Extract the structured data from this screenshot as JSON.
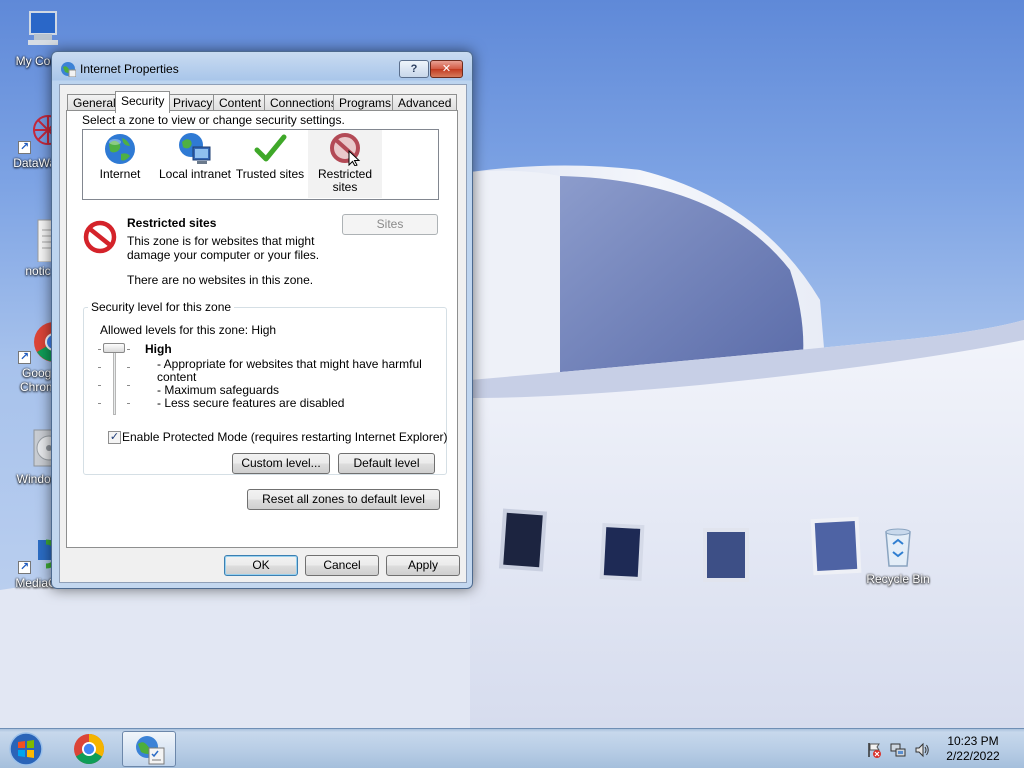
{
  "desktop": {
    "icons": [
      {
        "label": "My Com"
      },
      {
        "label": "DataWag"
      },
      {
        "label": "notic"
      },
      {
        "label": "Googl",
        "label2": "Chrom"
      },
      {
        "label": "Window"
      },
      {
        "label": "MediaCr"
      },
      {
        "label": "Recycle Bin"
      }
    ]
  },
  "window": {
    "title": "Internet Properties",
    "help_label": "?",
    "close_label": "✕",
    "tabs": [
      {
        "label": "General"
      },
      {
        "label": "Security"
      },
      {
        "label": "Privacy"
      },
      {
        "label": "Content"
      },
      {
        "label": "Connections"
      },
      {
        "label": "Programs"
      },
      {
        "label": "Advanced"
      }
    ],
    "active_tab": "Security",
    "security": {
      "zone_prompt": "Select a zone to view or change security settings.",
      "zones": [
        {
          "line1": "Internet",
          "line2": "",
          "icon": "globe-icon"
        },
        {
          "line1": "Local intranet",
          "line2": "",
          "icon": "intranet-icon"
        },
        {
          "line1": "Trusted sites",
          "line2": "",
          "icon": "checkmark-icon"
        },
        {
          "line1": "Restricted",
          "line2": "sites",
          "icon": "restricted-icon"
        }
      ],
      "selected_zone": "Restricted sites",
      "zone_title": "Restricted sites",
      "zone_desc1": "This zone is for websites that might",
      "zone_desc2": "damage your computer or your files.",
      "zone_desc3": "There are no websites in this zone.",
      "sites_button": "Sites",
      "group_title": "Security level for this zone",
      "allowed_levels": "Allowed levels for this zone: High",
      "level_name": "High",
      "level_lines": [
        "- Appropriate for websites that might have harmful",
        "content",
        "- Maximum safeguards",
        "- Less secure features are disabled"
      ],
      "protected_mode_label": "Enable Protected Mode (requires restarting Internet Explorer)",
      "protected_mode_checked": true,
      "custom_level_button": "Custom level...",
      "default_level_button": "Default level",
      "reset_all_button": "Reset all zones to default level"
    },
    "footer": {
      "ok": "OK",
      "cancel": "Cancel",
      "apply": "Apply"
    }
  },
  "taskbar": {
    "time": "10:23 PM",
    "date": "2/22/2022"
  },
  "colors": {
    "sky": "#7da3e4",
    "title_bar": "#a9c6ea",
    "close_red": "#c23a20",
    "restricted_red": "#d4232a",
    "trusted_green": "#3fa829"
  }
}
